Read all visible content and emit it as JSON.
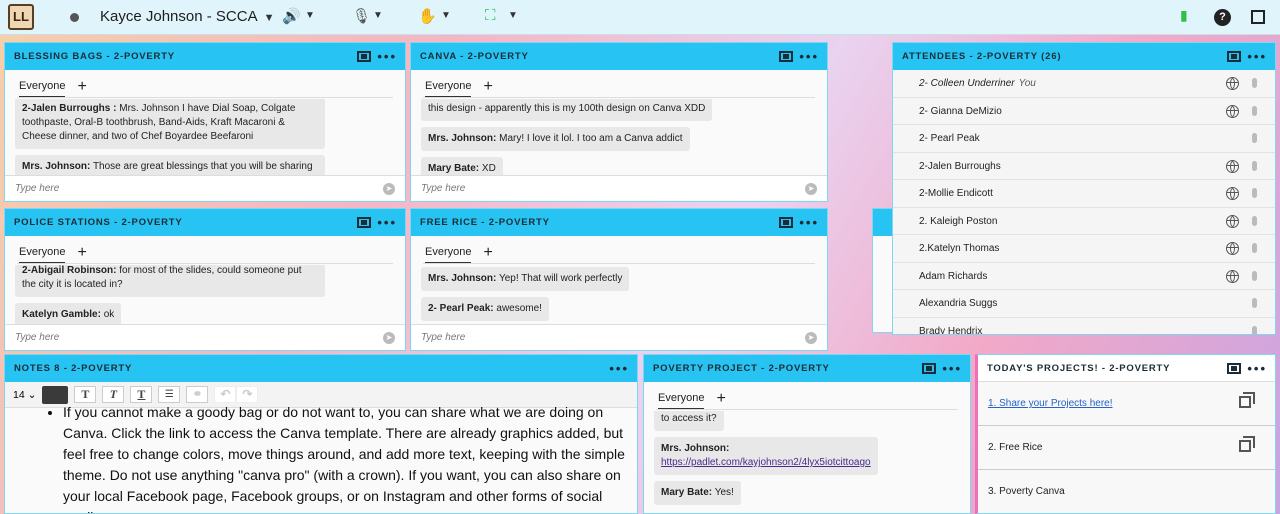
{
  "topbar": {
    "logo": "LL",
    "meeting_title": "Kayce Johnson - SCCA",
    "speaker_icon": "speaker-icon",
    "mic_icon": "mic-icon",
    "hand_icon": "raise-hand-icon",
    "share_icon": "share-screen-icon",
    "help": "?"
  },
  "pods": {
    "blessing": {
      "title": "BLESSING BAGS  - 2-POVERTY",
      "tab": "Everyone",
      "messages": [
        {
          "sender": "2-Jalen Burroughs :",
          "text": " Mrs. Johnson I have Dial Soap, Colgate toothpaste, Oral-B toothbrush, Band-Aids, Kraft Macaroni & Cheese dinner, and two of Chef Boyardee Beefaroni"
        },
        {
          "sender": "Mrs. Johnson:",
          "text": " Those are great blessings that you will be sharing ♥"
        }
      ],
      "placeholder": "Type here"
    },
    "canva": {
      "title": "CANVA  - 2-POVERTY",
      "tab": "Everyone",
      "messages": [
        {
          "sender": "",
          "text": "this design - apparently this is my 100th design on Canva XDD"
        },
        {
          "sender": "Mrs. Johnson:",
          "text": " Mary! I love it lol. I too am a Canva addict"
        },
        {
          "sender": "Mary Bate:",
          "text": " XD"
        }
      ],
      "placeholder": "Type here"
    },
    "police": {
      "title": "POLICE STATIONS  - 2-POVERTY",
      "tab": "Everyone",
      "messages": [
        {
          "sender": "2-Abigail Robinson:",
          "text": " for most of the slides, could someone put the city it is located in?"
        },
        {
          "sender": "Katelyn Gamble:",
          "text": " ok"
        }
      ],
      "placeholder": "Type here"
    },
    "rice": {
      "title": "FREE RICE  - 2-POVERTY",
      "tab": "Everyone",
      "messages": [
        {
          "sender": "Mrs. Johnson:",
          "text": " Yep! That will work perfectly"
        },
        {
          "sender": "2- Pearl Peak:",
          "text": " awesome!"
        }
      ],
      "placeholder": "Type here"
    },
    "attendees": {
      "title": "ATTENDEES - 2-POVERTY (26)",
      "rows": [
        {
          "name": "2- Colleen Underriner",
          "note": "You",
          "globe": true
        },
        {
          "name": "2- Gianna DeMizio",
          "note": "",
          "globe": true
        },
        {
          "name": "2- Pearl Peak",
          "note": "",
          "globe": false
        },
        {
          "name": "2-Jalen Burroughs",
          "note": "",
          "globe": true
        },
        {
          "name": "2-Mollie Endicott",
          "note": "",
          "globe": true
        },
        {
          "name": "2. Kaleigh Poston",
          "note": "",
          "globe": true
        },
        {
          "name": "2.Katelyn Thomas",
          "note": "",
          "globe": true
        },
        {
          "name": "Adam Richards",
          "note": "",
          "globe": true
        },
        {
          "name": "Alexandria Suggs",
          "note": "",
          "globe": false
        },
        {
          "name": "Brady Hendrix",
          "note": "",
          "globe": false
        }
      ]
    },
    "notes": {
      "title": "NOTES 8  - 2-POVERTY",
      "font_size": "14",
      "text_color": "#3a3a3a",
      "bullets": [
        "If you cannot make a goody bag or do not want to, you can share what we are doing on Canva. Click the link to access the Canva template. There are already graphics added, but feel free to change colors, move things around, and add more text, keeping with the simple theme. Do not use anything \"canva pro\" (with a crown). If you want, you can also share on your local Facebook page, Facebook groups, or on Instagram and other forms of social media."
      ]
    },
    "poverty": {
      "title": "POVERTY PROJECT  - 2-POVERTY",
      "tab": "Everyone",
      "messages": [
        {
          "sender": "",
          "text": "to access it?"
        },
        {
          "sender": "Mrs. Johnson:",
          "text": "",
          "link": "https://padlet.com/kayjohnson2/4lyx5iotcittoago"
        },
        {
          "sender": "Mary Bate:",
          "text": " Yes!"
        }
      ]
    },
    "projects": {
      "title": "TODAY'S PROJECTS!  - 2-POVERTY",
      "items": [
        {
          "label": "1. Share your Projects here!",
          "link": true,
          "copy": true
        },
        {
          "label": "2. Free Rice",
          "link": false,
          "copy": true
        },
        {
          "label": "3. Poverty Canva",
          "link": false,
          "copy": false
        }
      ]
    }
  },
  "colors": {
    "pod_header": "#27c4f3",
    "topbar": "#dff4fb"
  }
}
